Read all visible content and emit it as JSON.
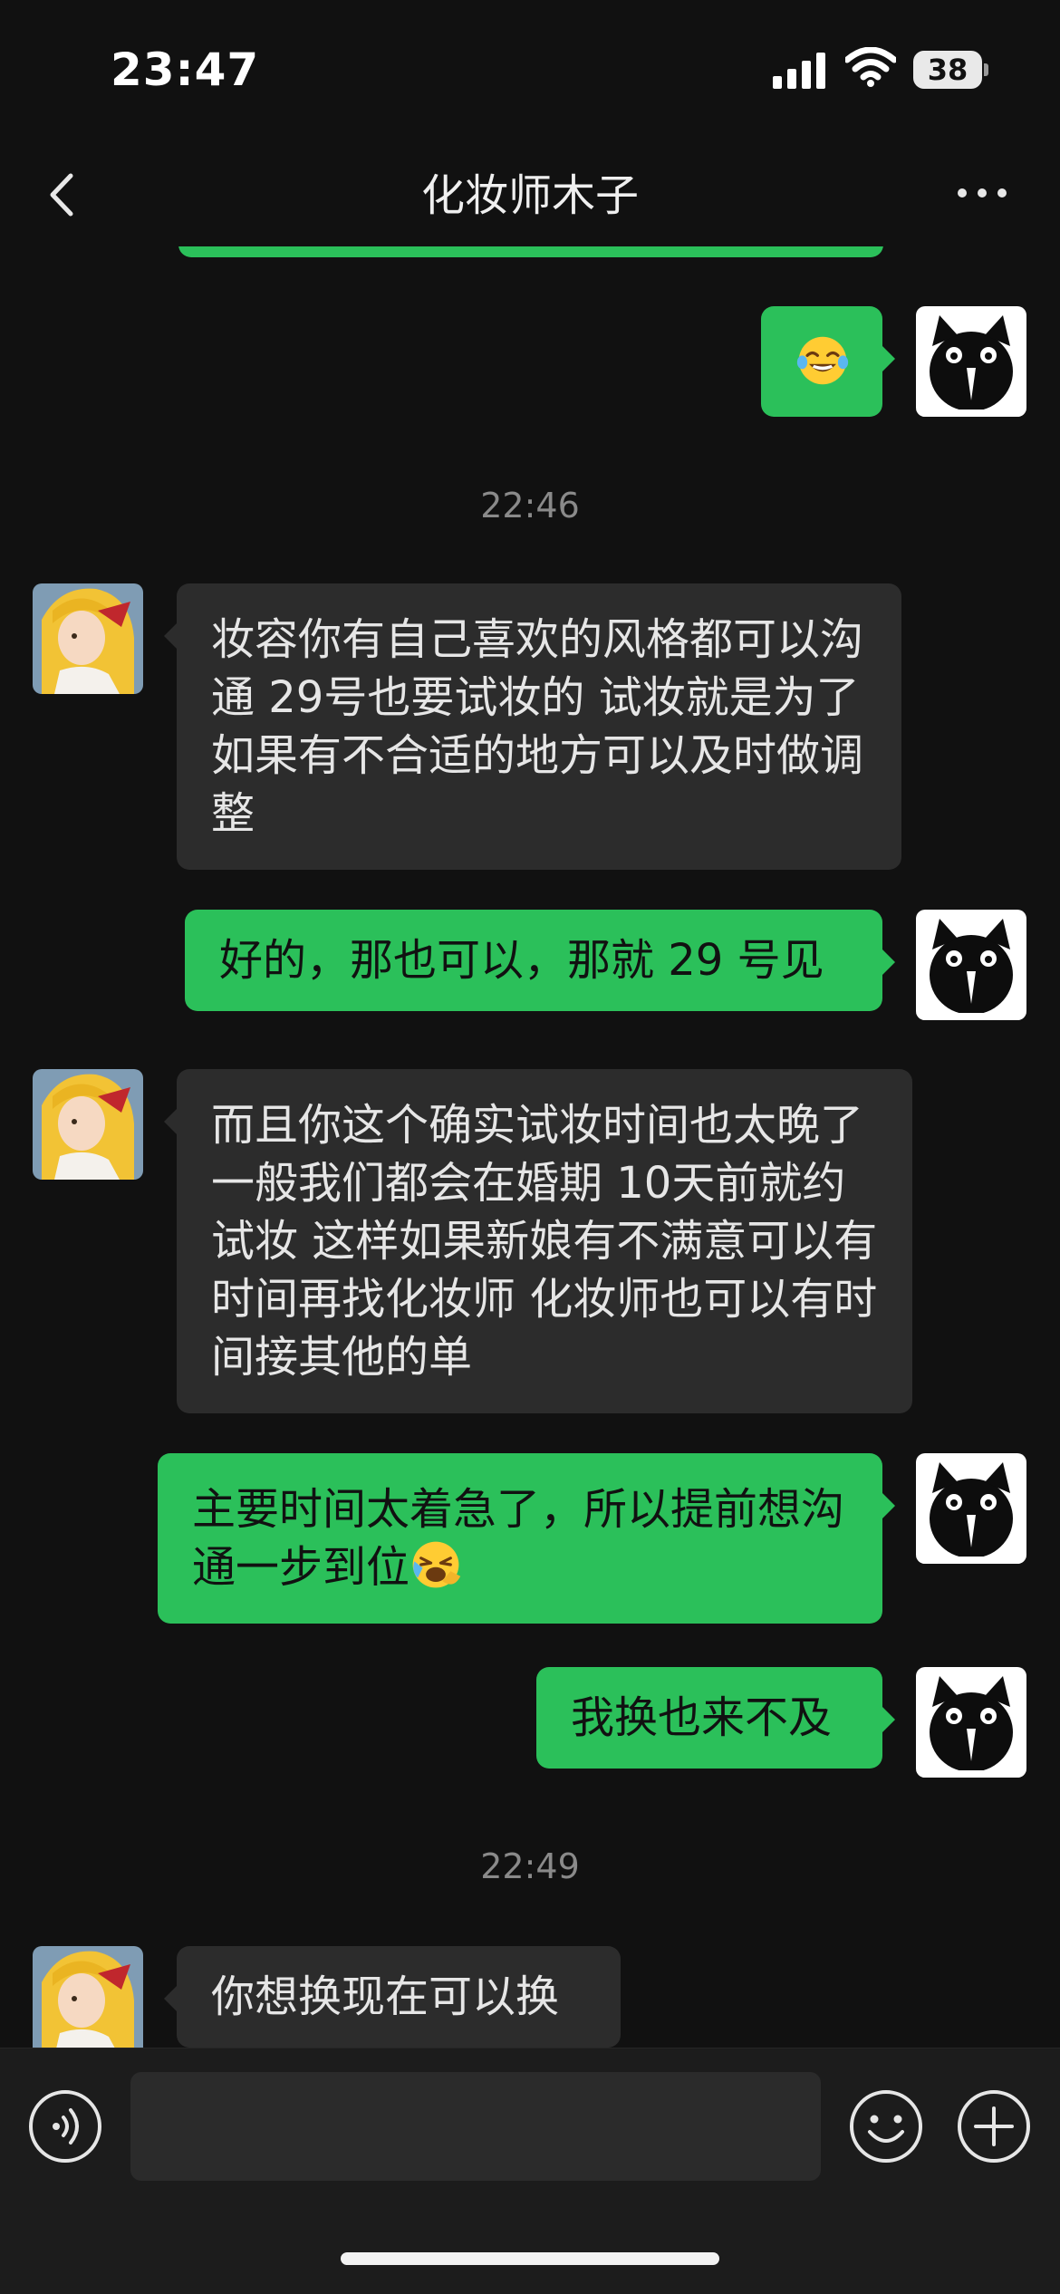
{
  "status_bar": {
    "time": "23:47",
    "battery": "38",
    "icons": [
      "signal-icon",
      "wifi-icon",
      "battery-icon"
    ]
  },
  "nav": {
    "title": "化妆师木子",
    "back_icon": "chevron-left-icon",
    "more_icon": "more-dots-icon"
  },
  "messages": [
    {
      "type": "out",
      "text": "",
      "emoji": "laughing-tears-emoji"
    },
    {
      "type": "time",
      "text": "22:46"
    },
    {
      "type": "in",
      "text": "妆容你有自己喜欢的风格都可以沟通 29号也要试妆的 试妆就是为了如果有不合适的地方可以及时做调整"
    },
    {
      "type": "out",
      "text": "好的，那也可以，那就 29 号见"
    },
    {
      "type": "in",
      "text": "而且你这个确实试妆时间也太晚了 一般我们都会在婚期 10天前就约试妆 这样如果新娘有不满意可以有时间再找化妆师 化妆师也可以有时间接其他的单"
    },
    {
      "type": "out",
      "text": "主要时间太着急了，所以提前想沟通一步到位",
      "emoji": "sob-laugh-emoji"
    },
    {
      "type": "out",
      "text": "我换也来不及"
    },
    {
      "type": "time",
      "text": "22:49"
    },
    {
      "type": "in",
      "text": "你想换现在可以换"
    }
  ],
  "input_bar": {
    "voice_icon": "voice-icon",
    "emoji_icon": "smiley-icon",
    "plus_icon": "plus-icon",
    "input_value": ""
  },
  "colors": {
    "background": "#111111",
    "outgoing_bubble": "#2bc05a",
    "incoming_bubble": "#2c2c2c",
    "timestamp": "#8a8a8a"
  }
}
